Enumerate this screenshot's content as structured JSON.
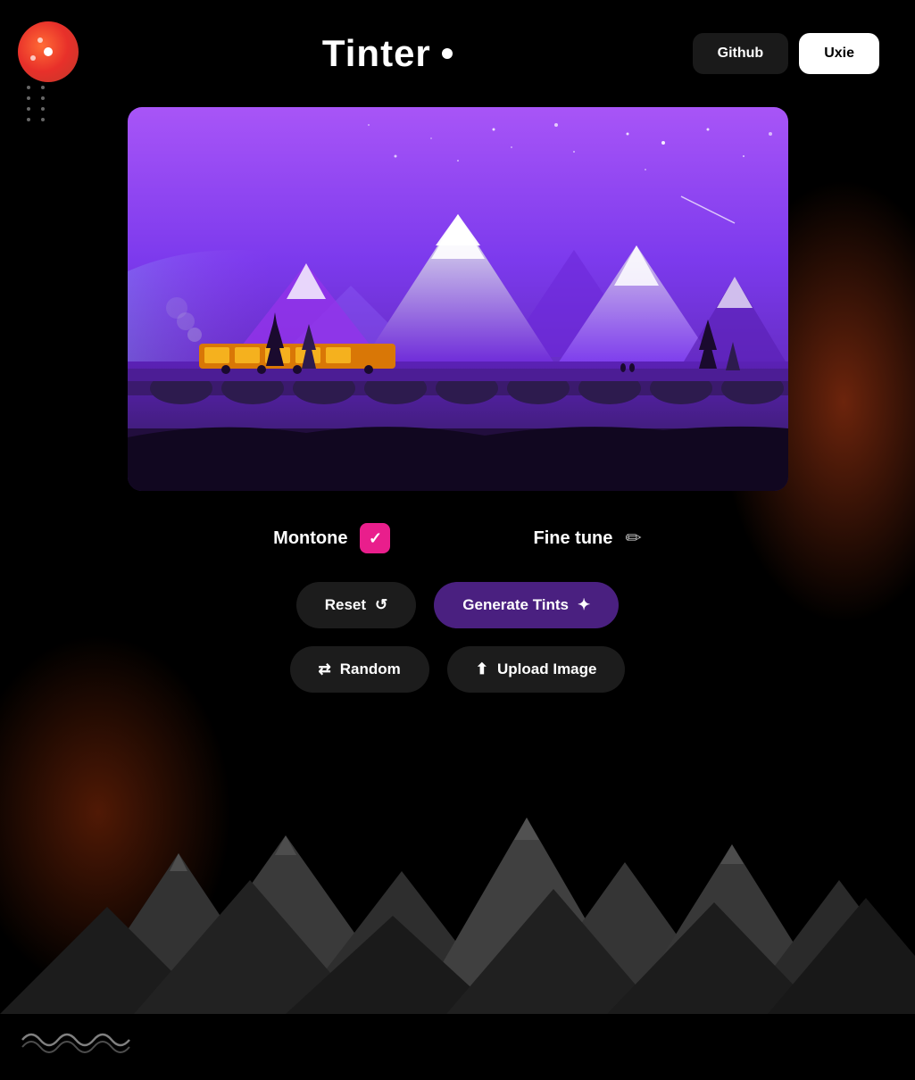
{
  "header": {
    "title": "Tinter",
    "github_label": "Github",
    "uxie_label": "Uxie"
  },
  "controls": {
    "monotone_label": "Montone",
    "monotone_checked": true,
    "fine_tune_label": "Fine tune"
  },
  "buttons": {
    "reset_label": "Reset",
    "generate_label": "Generate Tints",
    "random_label": "Random",
    "upload_label": "Upload Image"
  },
  "icons": {
    "reset": "↺",
    "generate": "✦",
    "random": "⇄",
    "upload": "⬆",
    "pencil": "✏",
    "checkmark": "✓",
    "wave": "⌒⌒⌒⌒⌒"
  }
}
